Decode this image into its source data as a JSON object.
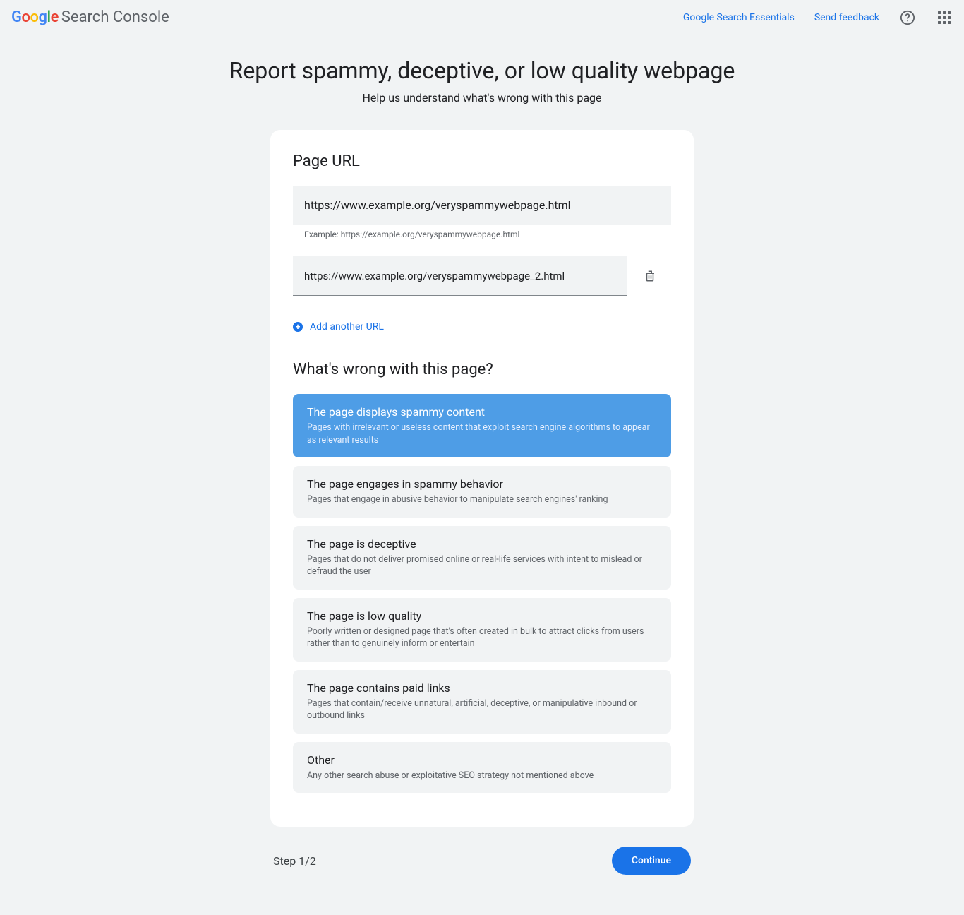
{
  "header": {
    "logo_suffix": "Search Console",
    "links": {
      "essentials": "Google Search Essentials",
      "feedback": "Send feedback"
    }
  },
  "page": {
    "title": "Report spammy, deceptive, or low quality webpage",
    "subtitle": "Help us understand what's wrong with this page"
  },
  "form": {
    "url_section_title": "Page URL",
    "urls": [
      {
        "value": "https://www.example.org/veryspammywebpage.html"
      },
      {
        "value": "https://www.example.org/veryspammywebpage_2.html"
      }
    ],
    "example_text": "Example: https://example.org/veryspammywebpage.html",
    "add_url_label": "Add another URL",
    "issue_section_title": "What's wrong with this page?",
    "options": [
      {
        "title": "The page displays spammy content",
        "desc": "Pages with irrelevant or useless content that exploit search engine algorithms to appear as relevant results",
        "selected": true
      },
      {
        "title": "The page engages in spammy behavior",
        "desc": "Pages that engage in abusive behavior to manipulate search engines' ranking",
        "selected": false
      },
      {
        "title": "The page is deceptive",
        "desc": "Pages that do not deliver promised online or real-life services with intent to mislead or defraud the user",
        "selected": false
      },
      {
        "title": "The page is low quality",
        "desc": "Poorly written or designed page that's often created in bulk to attract clicks from users rather than to genuinely inform or entertain",
        "selected": false
      },
      {
        "title": "The page contains paid links",
        "desc": "Pages that contain/receive unnatural, artificial, deceptive, or manipulative inbound or outbound links",
        "selected": false
      },
      {
        "title": "Other",
        "desc": "Any other search abuse or exploitative SEO strategy not mentioned above",
        "selected": false
      }
    ]
  },
  "footer": {
    "step": "Step 1/2",
    "continue": "Continue"
  }
}
